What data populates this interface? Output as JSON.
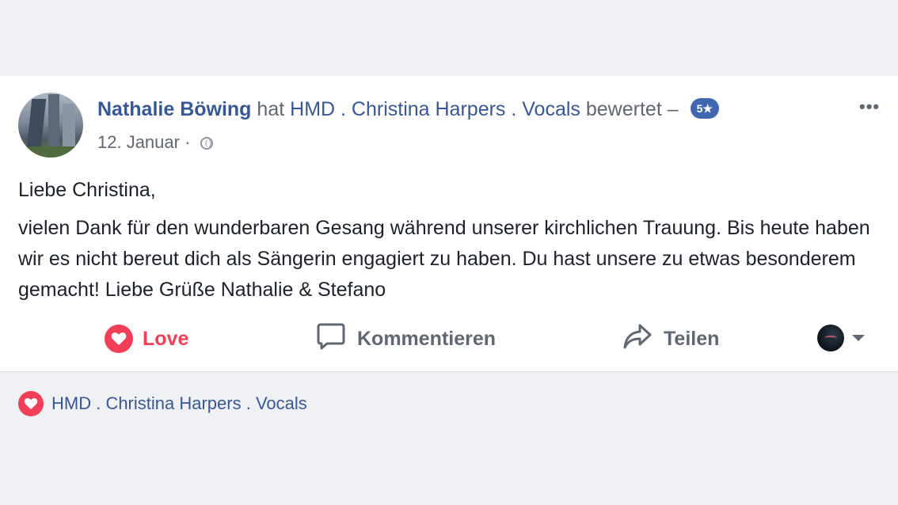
{
  "post": {
    "author": "Nathalie Böwing",
    "verb_pre": "hat",
    "page_name": "HMD . Christina Harpers . Vocals",
    "verb_post": "bewertet –",
    "rating_badge": "5★",
    "more_label": "•••",
    "date": "12. Januar",
    "separator": "·",
    "greeting": "Liebe Christina,",
    "body": "vielen Dank für den wunderbaren Gesang während unserer kirchlichen Trauung. Bis heute haben wir es nicht bereut dich als Sängerin engagiert zu haben. Du hast unsere zu etwas besonderem gemacht! Liebe Grüße Nathalie & Stefano"
  },
  "actions": {
    "love_label": "Love",
    "comment_label": "Kommentieren",
    "share_label": "Teilen"
  },
  "reactions": {
    "reactor_name": "HMD . Christina Harpers . Vocals"
  },
  "icons": {
    "love": "heart-icon",
    "comment": "comment-bubble-icon",
    "share": "share-arrow-icon",
    "audience": "globe-icon",
    "more": "more-options-icon",
    "dropdown": "chevron-down-icon"
  },
  "colors": {
    "link_blue": "#365899",
    "love_red": "#f33e58",
    "badge_blue": "#4267b2",
    "muted_gray": "#606770",
    "background": "#f0f1f4"
  }
}
